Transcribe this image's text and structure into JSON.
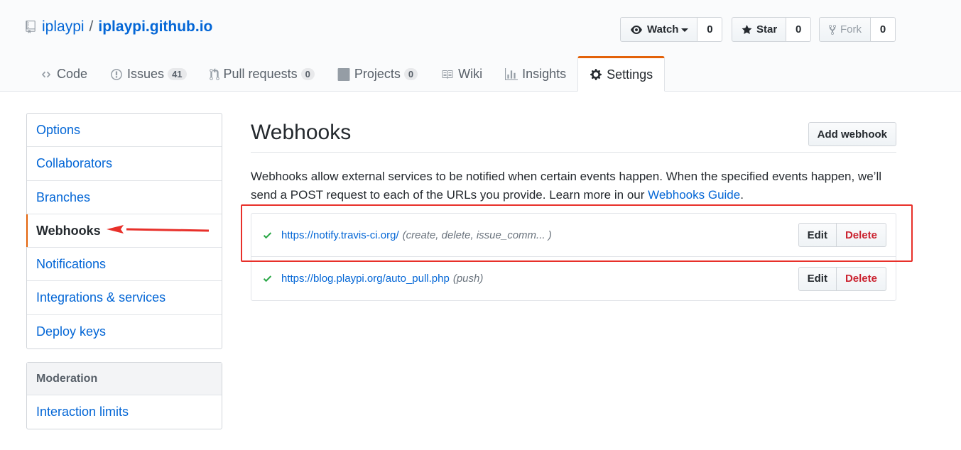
{
  "repo": {
    "owner": "iplaypi",
    "separator": "/",
    "name": "iplaypi.github.io"
  },
  "social": {
    "watch_label": "Watch",
    "watch_count": "0",
    "star_label": "Star",
    "star_count": "0",
    "fork_label": "Fork",
    "fork_count": "0"
  },
  "tabs": [
    {
      "label": "Code",
      "icon": "code-icon"
    },
    {
      "label": "Issues",
      "counter": "41",
      "icon": "issue-icon"
    },
    {
      "label": "Pull requests",
      "counter": "0",
      "icon": "pull-request-icon"
    },
    {
      "label": "Projects",
      "counter": "0",
      "icon": "project-icon"
    },
    {
      "label": "Wiki",
      "icon": "book-icon"
    },
    {
      "label": "Insights",
      "icon": "graph-icon"
    },
    {
      "label": "Settings",
      "icon": "gear-icon",
      "selected": true
    }
  ],
  "menu": {
    "items": [
      {
        "label": "Options"
      },
      {
        "label": "Collaborators"
      },
      {
        "label": "Branches"
      },
      {
        "label": "Webhooks",
        "selected": true
      },
      {
        "label": "Notifications"
      },
      {
        "label": "Integrations & services"
      },
      {
        "label": "Deploy keys"
      }
    ]
  },
  "moderation": {
    "heading": "Moderation",
    "items": [
      {
        "label": "Interaction limits"
      }
    ]
  },
  "main": {
    "title": "Webhooks",
    "add_button": "Add webhook",
    "description": "Webhooks allow external services to be notified when certain events happen. When the specified events happen, we’ll send a POST request to each of the URLs you provide. Learn more in our ",
    "guide_link": "Webhooks Guide",
    "description_end": "."
  },
  "hooks": [
    {
      "url": "https://notify.travis-ci.org/",
      "events": "(create, delete, issue_comm... )",
      "edit": "Edit",
      "delete": "Delete",
      "status": "success"
    },
    {
      "url": "https://blog.playpi.org/auto_pull.php",
      "events": "(push)",
      "edit": "Edit",
      "delete": "Delete",
      "status": "success"
    }
  ],
  "colors": {
    "accent": "#e36209",
    "link": "#0366d6",
    "success": "#28a745",
    "danger": "#cb2431",
    "annotation": "#e8302a"
  }
}
